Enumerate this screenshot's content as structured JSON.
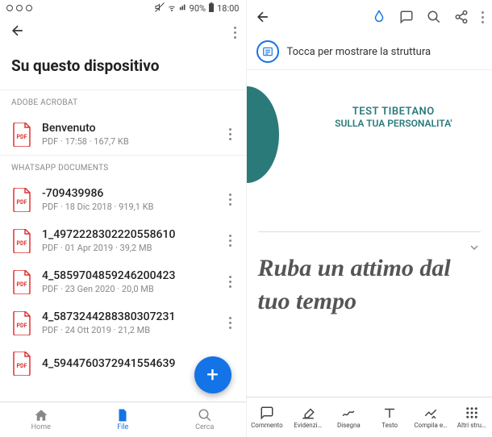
{
  "status": {
    "battery": "90%",
    "time": "18:00"
  },
  "left": {
    "title": "Su questo dispositivo",
    "sections": [
      {
        "label": "ADOBE ACROBAT",
        "items": [
          {
            "name": "Benvenuto",
            "meta": "PDF  ·  17:58  ·  167,7 KB"
          }
        ]
      },
      {
        "label": "WHATSAPP DOCUMENTS",
        "items": [
          {
            "name": "-709439986",
            "meta": "PDF  ·  18 Dic 2018  ·  919,1 KB"
          },
          {
            "name": "1_4972228302220558610",
            "meta": "PDF  ·  01 Apr 2019  ·  39,2 MB"
          },
          {
            "name": "4_5859704859246200423",
            "meta": "PDF  ·  23 Gen 2020  ·  20,0 MB"
          },
          {
            "name": "4_5873244288380307231",
            "meta": "PDF  ·  24 Ott 2019  ·  21,2 MB"
          },
          {
            "name": "4_5944760372941554639",
            "meta": ""
          }
        ]
      }
    ],
    "nav": {
      "home": "Home",
      "file": "File",
      "cerca": "Cerca"
    }
  },
  "right": {
    "struct": "Tocca per mostrare la struttura",
    "doc": {
      "title1": "TEST TIBETANO",
      "title2": "SULLA TUA PERSONALITA'",
      "body": "Ruba un attimo dal tuo tempo"
    },
    "tools": {
      "commento": "Commento",
      "evidenzia": "Evidenzi…",
      "disegna": "Disegna",
      "testo": "Testo",
      "compila": "Compila e…",
      "altri": "Altri stru…"
    }
  }
}
